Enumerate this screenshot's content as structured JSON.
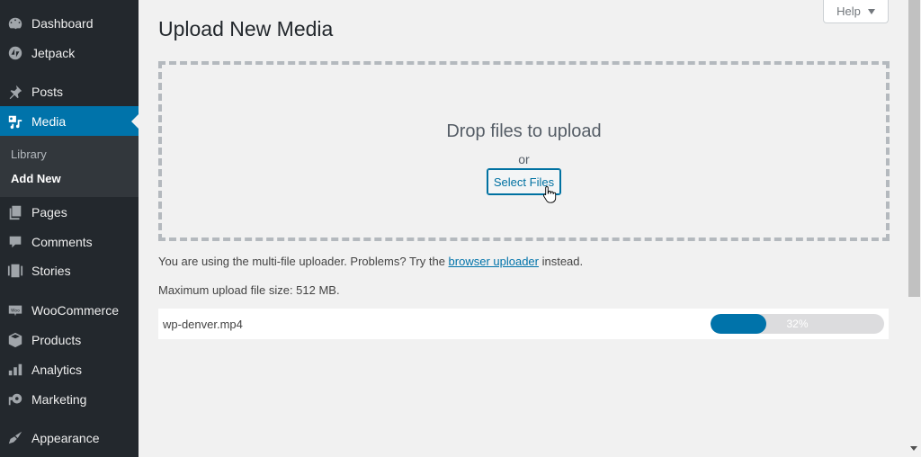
{
  "sidebar": {
    "items": [
      {
        "label": "Dashboard",
        "icon": "dashboard-icon"
      },
      {
        "label": "Jetpack",
        "icon": "jetpack-icon"
      },
      {
        "label": "Posts",
        "icon": "pin-icon"
      },
      {
        "label": "Media",
        "icon": "media-icon",
        "active": true
      },
      {
        "label": "Pages",
        "icon": "pages-icon"
      },
      {
        "label": "Comments",
        "icon": "comment-icon"
      },
      {
        "label": "Stories",
        "icon": "stories-icon"
      },
      {
        "label": "WooCommerce",
        "icon": "woo-icon"
      },
      {
        "label": "Products",
        "icon": "box-icon"
      },
      {
        "label": "Analytics",
        "icon": "bar-chart-icon"
      },
      {
        "label": "Marketing",
        "icon": "megaphone-icon"
      },
      {
        "label": "Appearance",
        "icon": "paintbrush-icon"
      }
    ],
    "submenu": [
      {
        "label": "Library"
      },
      {
        "label": "Add New",
        "current": true
      }
    ]
  },
  "header": {
    "title": "Upload New Media",
    "help_label": "Help"
  },
  "uploader": {
    "drop_title": "Drop files to upload",
    "or_text": "or",
    "select_files_label": "Select Files",
    "info_prefix": "You are using the multi-file uploader. Problems? Try the ",
    "info_link": "browser uploader",
    "info_suffix": " instead.",
    "max_size_text": "Maximum upload file size: 512 MB."
  },
  "upload_item": {
    "file_name": "wp-denver.mp4",
    "progress_percent": 32,
    "progress_label": "32%"
  },
  "colors": {
    "accent": "#0073aa",
    "sidebar_bg": "#23282d",
    "submenu_bg": "#32373c",
    "page_bg": "#f1f1f1"
  }
}
